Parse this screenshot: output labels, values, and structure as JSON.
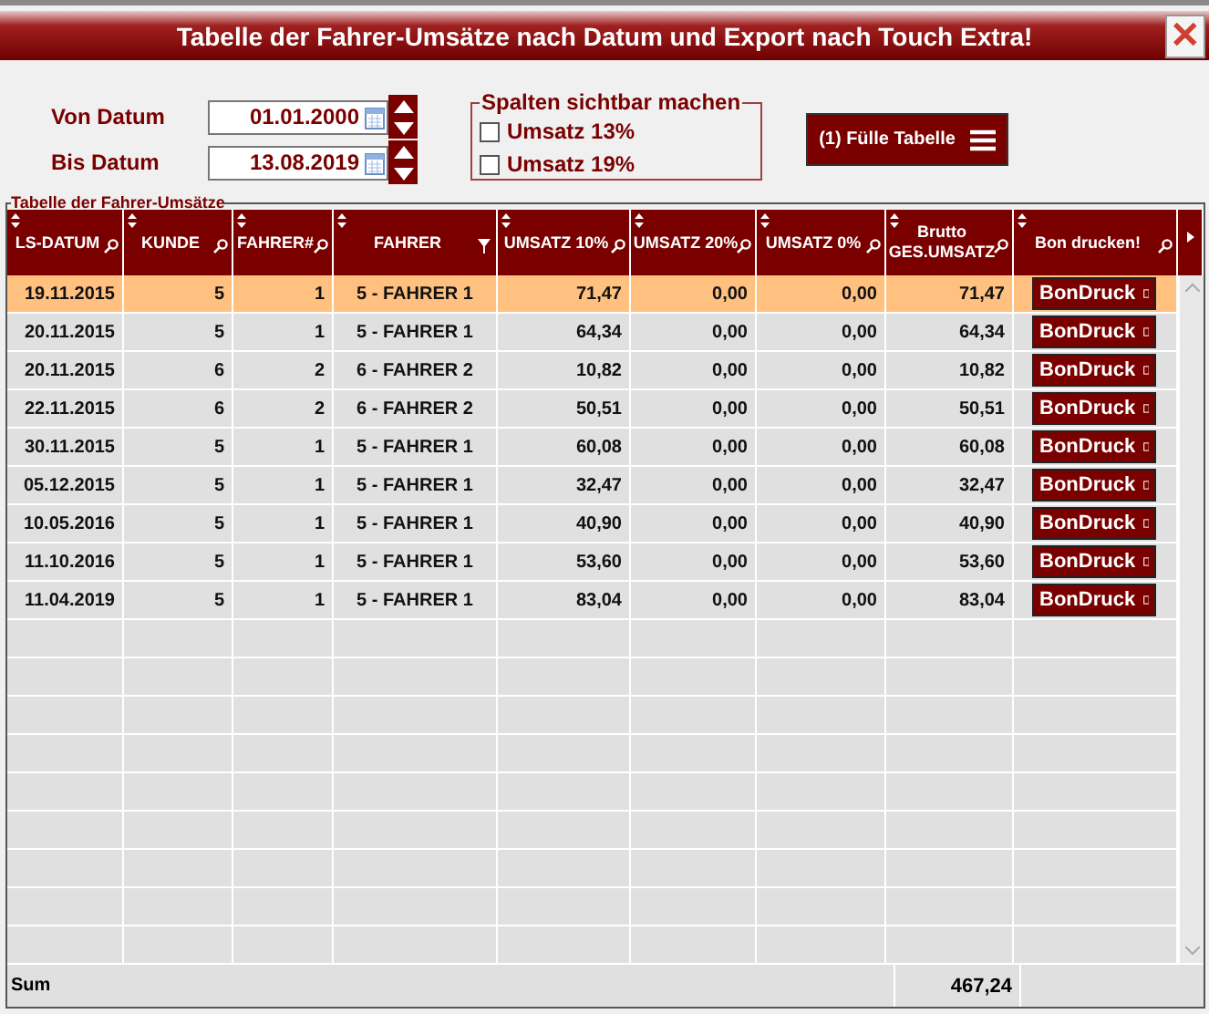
{
  "window": {
    "title": "Tabelle der Fahrer-Umsätze nach Datum und Export nach Touch Extra!",
    "close_label": "✕"
  },
  "dates": [
    {
      "label": "Von Datum",
      "value": "01.01.2000"
    },
    {
      "label": "Bis Datum",
      "value": "13.08.2019"
    }
  ],
  "columns_group": {
    "title": "Spalten sichtbar machen",
    "options": [
      {
        "label": "Umsatz 13%",
        "checked": false
      },
      {
        "label": "Umsatz 19%",
        "checked": false
      }
    ]
  },
  "fill_button": {
    "label": "(1) Fülle Tabelle"
  },
  "table": {
    "title": "Tabelle der Fahrer-Umsätze",
    "columns": [
      {
        "label": "LS-DATUM",
        "kind": "search"
      },
      {
        "label": "KUNDE",
        "kind": "search"
      },
      {
        "label": "FAHRER#",
        "kind": "search"
      },
      {
        "label": "FAHRER",
        "kind": "filter"
      },
      {
        "label": "UMSATZ 10%",
        "kind": "search"
      },
      {
        "label": "UMSATZ 20%",
        "kind": "search"
      },
      {
        "label": "UMSATZ 0%",
        "kind": "search"
      },
      {
        "label": "Brutto GES.UMSATZ",
        "kind": "search"
      },
      {
        "label": "Bon drucken!",
        "kind": "search"
      }
    ],
    "rows": [
      {
        "selected": true,
        "cells": [
          "19.11.2015",
          "5",
          "1",
          "5 - FAHRER 1",
          "71,47",
          "0,00",
          "0,00",
          "71,47"
        ],
        "button": "BonDruck"
      },
      {
        "selected": false,
        "cells": [
          "20.11.2015",
          "5",
          "1",
          "5 - FAHRER 1",
          "64,34",
          "0,00",
          "0,00",
          "64,34"
        ],
        "button": "BonDruck"
      },
      {
        "selected": false,
        "cells": [
          "20.11.2015",
          "6",
          "2",
          "6 - FAHRER 2",
          "10,82",
          "0,00",
          "0,00",
          "10,82"
        ],
        "button": "BonDruck"
      },
      {
        "selected": false,
        "cells": [
          "22.11.2015",
          "6",
          "2",
          "6 - FAHRER 2",
          "50,51",
          "0,00",
          "0,00",
          "50,51"
        ],
        "button": "BonDruck"
      },
      {
        "selected": false,
        "cells": [
          "30.11.2015",
          "5",
          "1",
          "5 - FAHRER 1",
          "60,08",
          "0,00",
          "0,00",
          "60,08"
        ],
        "button": "BonDruck"
      },
      {
        "selected": false,
        "cells": [
          "05.12.2015",
          "5",
          "1",
          "5 - FAHRER 1",
          "32,47",
          "0,00",
          "0,00",
          "32,47"
        ],
        "button": "BonDruck"
      },
      {
        "selected": false,
        "cells": [
          "10.05.2016",
          "5",
          "1",
          "5 - FAHRER 1",
          "40,90",
          "0,00",
          "0,00",
          "40,90"
        ],
        "button": "BonDruck"
      },
      {
        "selected": false,
        "cells": [
          "11.10.2016",
          "5",
          "1",
          "5 - FAHRER 1",
          "53,60",
          "0,00",
          "0,00",
          "53,60"
        ],
        "button": "BonDruck"
      },
      {
        "selected": false,
        "cells": [
          "11.04.2019",
          "5",
          "1",
          "5 - FAHRER 1",
          "83,04",
          "0,00",
          "0,00",
          "83,04"
        ],
        "button": "BonDruck"
      }
    ],
    "sum": {
      "label": "Sum",
      "total": "467,24"
    }
  }
}
